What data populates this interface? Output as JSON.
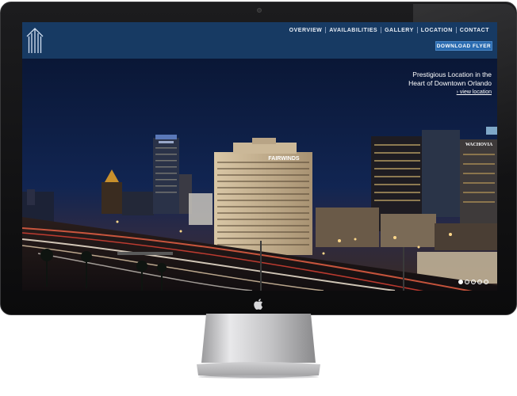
{
  "nav": {
    "items": [
      {
        "label": "OVERVIEW"
      },
      {
        "label": "AVAILABILITIES"
      },
      {
        "label": "GALLERY"
      },
      {
        "label": "LOCATION"
      },
      {
        "label": "CONTACT"
      }
    ],
    "download_label": "DOWNLOAD FLYER"
  },
  "hero": {
    "tagline_line1": "Prestigious Location in the",
    "tagline_line2": "Heart of Downtown Orlando",
    "link_label": "› view location",
    "building_sign": "FAIRWINDS",
    "tower_sign": "WACHOVIA"
  },
  "slideshow": {
    "count": 5,
    "active_index": 0
  },
  "colors": {
    "header": "#173a63",
    "button": "#2a6bb0",
    "sky": "#0d1f48"
  }
}
